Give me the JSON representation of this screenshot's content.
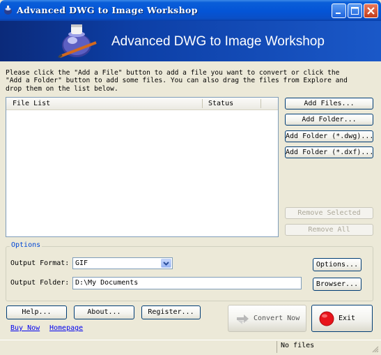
{
  "window": {
    "title": "Advanced DWG to Image Workshop",
    "banner_title": "Advanced DWG to Image Workshop"
  },
  "instructions": "Please click the \"Add a File\" button to add a file you want to convert or click the\n\"Add a Folder\" button to add some files. You can also drag the files from Explore and\ndrop them on the list below.",
  "file_list": {
    "columns": [
      "File List",
      "Status"
    ],
    "rows": []
  },
  "side_buttons": {
    "add_files": "Add Files...",
    "add_folder": "Add Folder...",
    "add_folder_dwg": "Add Folder (*.dwg)...",
    "add_folder_dxf": "Add Folder (*.dxf)...",
    "remove_selected": "Remove Selected",
    "remove_all": "Remove All"
  },
  "options": {
    "legend": "Options",
    "format_label": "Output Format:",
    "format_value": "GIF",
    "folder_label": "Output Folder:",
    "folder_value": "D:\\My Documents",
    "options_button": "Options...",
    "browse_button": "Browser..."
  },
  "bottom": {
    "help": "Help...",
    "about": "About...",
    "register": "Register...",
    "convert": "Convert Now",
    "exit": "Exit",
    "buy_now": "Buy Now",
    "homepage": "Homepage"
  },
  "status": {
    "text": "No files"
  },
  "colors": {
    "titlebar": "#0454d6",
    "banner": "#0d3fa6",
    "window_bg": "#ece9d8",
    "legend_text": "#0046d5",
    "exit_icon": "#e8141b"
  },
  "icons": {
    "app": "app-icon",
    "banner_logo": "inkpot-pen-icon",
    "minimize": "minimize-icon",
    "maximize": "maximize-icon",
    "close": "close-icon",
    "convert": "convert-arrows-icon",
    "exit": "stop-icon",
    "dropdown": "chevron-down-icon"
  }
}
